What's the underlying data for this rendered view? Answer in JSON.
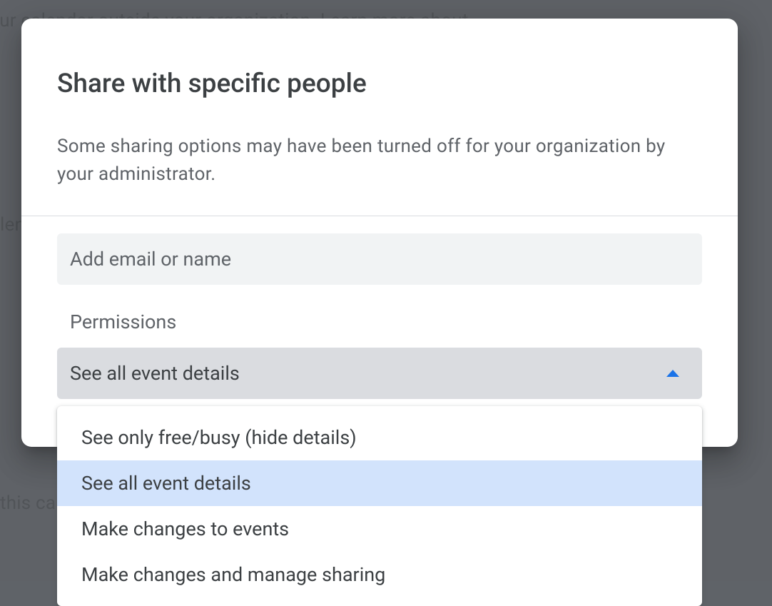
{
  "background": {
    "line1": "share your calendar outside your organization. Learn more about",
    "line2": "len",
    "line3": "this cal"
  },
  "dialog": {
    "title": "Share with specific people",
    "subtitle": "Some sharing options may have been turned off for your organization by your administrator.",
    "emailPlaceholder": "Add email or name",
    "permissionsLabel": "Permissions",
    "selectedValue": "See all event details",
    "options": [
      "See only free/busy (hide details)",
      "See all event details",
      "Make changes to events",
      "Make changes and manage sharing"
    ],
    "selectedIndex": 1
  }
}
